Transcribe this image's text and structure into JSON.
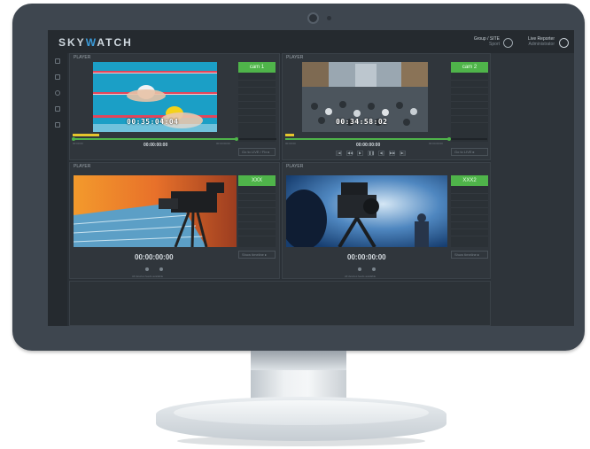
{
  "app": {
    "logo_prefix": "SKY",
    "logo_mid": "W",
    "logo_suffix": "ATCH"
  },
  "header": {
    "group_name": "Group / SITE",
    "group_sub": "Sport",
    "user_name": "Live Reporter",
    "user_sub": "Administrator"
  },
  "players": [
    {
      "label": "PLAYER",
      "overlay_timecode": "00:35:04:04",
      "cam_label": "cam 1",
      "timecode": "00:00:00:00",
      "start_label": "00:00:00",
      "end_label": "00:04:00:00",
      "button_label": "Go to LIVE / Fix ▸",
      "progress": 0.05
    },
    {
      "label": "PLAYER",
      "overlay_timecode": "00:34:58:02",
      "cam_label": "cam 2",
      "timecode": "00:00:00:00",
      "start_label": "00:00:00",
      "end_label": "00:04:00:00",
      "button_label": "Go to LIVE ▸",
      "progress": 0.05
    },
    {
      "label": "PLAYER",
      "cam_label": "XXX",
      "timecode": "00:00:00:00",
      "button_label": "Show timeline ▸",
      "hint": "All devices feeds available"
    },
    {
      "label": "PLAYER",
      "cam_label": "XXX2",
      "timecode": "00:00:00:00",
      "button_label": "Show timeline ▸",
      "hint": "All devices feeds available"
    }
  ],
  "transport": {
    "icons": [
      "skip-start-icon",
      "rewind-icon",
      "play-icon",
      "pause-icon",
      "step-back-icon",
      "fast-forward-icon",
      "skip-end-icon"
    ],
    "glyphs": [
      "|◀",
      "◀◀",
      "▶",
      "❚❚",
      "◀|",
      "▶▶",
      "▶|"
    ]
  },
  "colors": {
    "accent_green": "#4fb44a",
    "accent_yellow": "#e6c52c",
    "logo_blue": "#3b9ad8"
  }
}
